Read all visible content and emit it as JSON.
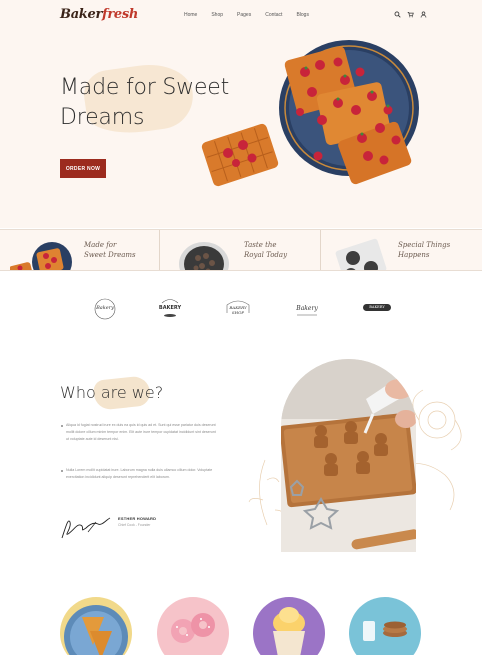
{
  "brand": {
    "logo_main": "Baker",
    "logo_accent": "fresh"
  },
  "nav": {
    "items": [
      "Home",
      "Shop",
      "Pages",
      "Contact",
      "Blogs"
    ]
  },
  "header_icons": [
    "search-icon",
    "cart-icon",
    "user-icon"
  ],
  "hero": {
    "title_line1": "Made for Sweet",
    "title_line2": "Dreams",
    "cta": "ORDER NOW"
  },
  "features": [
    {
      "line1": "Made for",
      "line2": "Sweet Dreams"
    },
    {
      "line1": "Taste the",
      "line2": "Royal Today"
    },
    {
      "line1": "Special Things",
      "line2": "Happens"
    }
  ],
  "partner_logos": [
    {
      "label": "Bakery"
    },
    {
      "label": "BAKERY"
    },
    {
      "label": "BAKERY SHOP"
    },
    {
      "label": "Bakery"
    },
    {
      "label": "BAKERY"
    }
  ],
  "about": {
    "title": "Who are we?",
    "para1": "Aliqua id fugiat nostrud irure ex duis ea quis id quis ad et. Sunt qui esse pariatur duis deserunt mollit dolore cillum minim tempor enim. Elit aute irure tempor cupidatat incididunt sint deserunt ut voluptate aute id deserunt nisi.",
    "para2": "Nulla Lorem mollit cupidatat irure. Laborum magna nulla duis ullamco cillum dolor. Voluptate exercitation incididunt aliquip deserunt reprehenderit elit laborum.",
    "signature_name": "ESTHER HOWARD",
    "signature_role": "Chief Cook - Founder"
  },
  "colors": {
    "accent": "#9c2b1e",
    "cream": "#fdf6f1",
    "brush": "#f6e6cf"
  }
}
